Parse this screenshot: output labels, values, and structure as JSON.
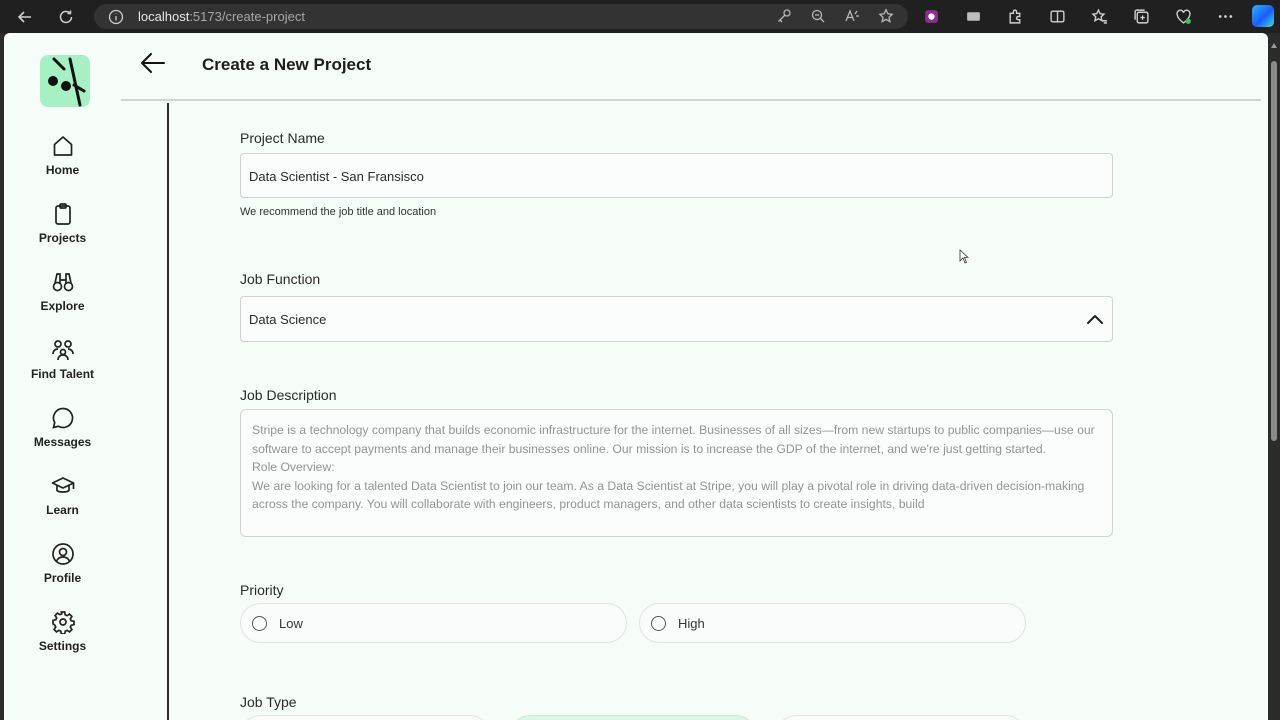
{
  "browser": {
    "url_host": "localhost",
    "url_path": ":5173/create-project"
  },
  "sidebar": {
    "items": [
      {
        "label": "Home",
        "icon": "home-icon"
      },
      {
        "label": "Projects",
        "icon": "clipboard-icon"
      },
      {
        "label": "Explore",
        "icon": "binoculars-icon"
      },
      {
        "label": "Find Talent",
        "icon": "people-icon"
      },
      {
        "label": "Messages",
        "icon": "chat-bubble-icon"
      },
      {
        "label": "Learn",
        "icon": "graduation-cap-icon"
      },
      {
        "label": "Profile",
        "icon": "user-circle-icon"
      },
      {
        "label": "Settings",
        "icon": "gear-icon"
      }
    ]
  },
  "header": {
    "title": "Create a New Project"
  },
  "form": {
    "project_name": {
      "label": "Project Name",
      "value": "Data Scientist - San Fransisco",
      "helper": "We recommend the job title and location"
    },
    "job_function": {
      "label": "Job Function",
      "value": "Data Science"
    },
    "job_description": {
      "label": "Job Description",
      "lines": [
        "Stripe is a technology company that builds economic infrastructure for the internet. Businesses of all sizes—from new startups to public companies—use our software to accept payments and manage their businesses online. Our mission is to increase the GDP of the internet, and we're just getting started.",
        "Role Overview:",
        "We are looking for a talented Data Scientist to join our team. As a Data Scientist at Stripe, you will play a pivotal role in driving data-driven decision-making across the company. You will collaborate with engineers, product managers, and other data scientists to create insights, build"
      ]
    },
    "priority": {
      "label": "Priority",
      "options": [
        "Low",
        "High"
      ]
    },
    "job_type": {
      "label": "Job Type"
    }
  },
  "colors": {
    "app_background": "#f6fcf7",
    "logo_background": "#a7f0c3",
    "browser_chrome": "#202020"
  }
}
